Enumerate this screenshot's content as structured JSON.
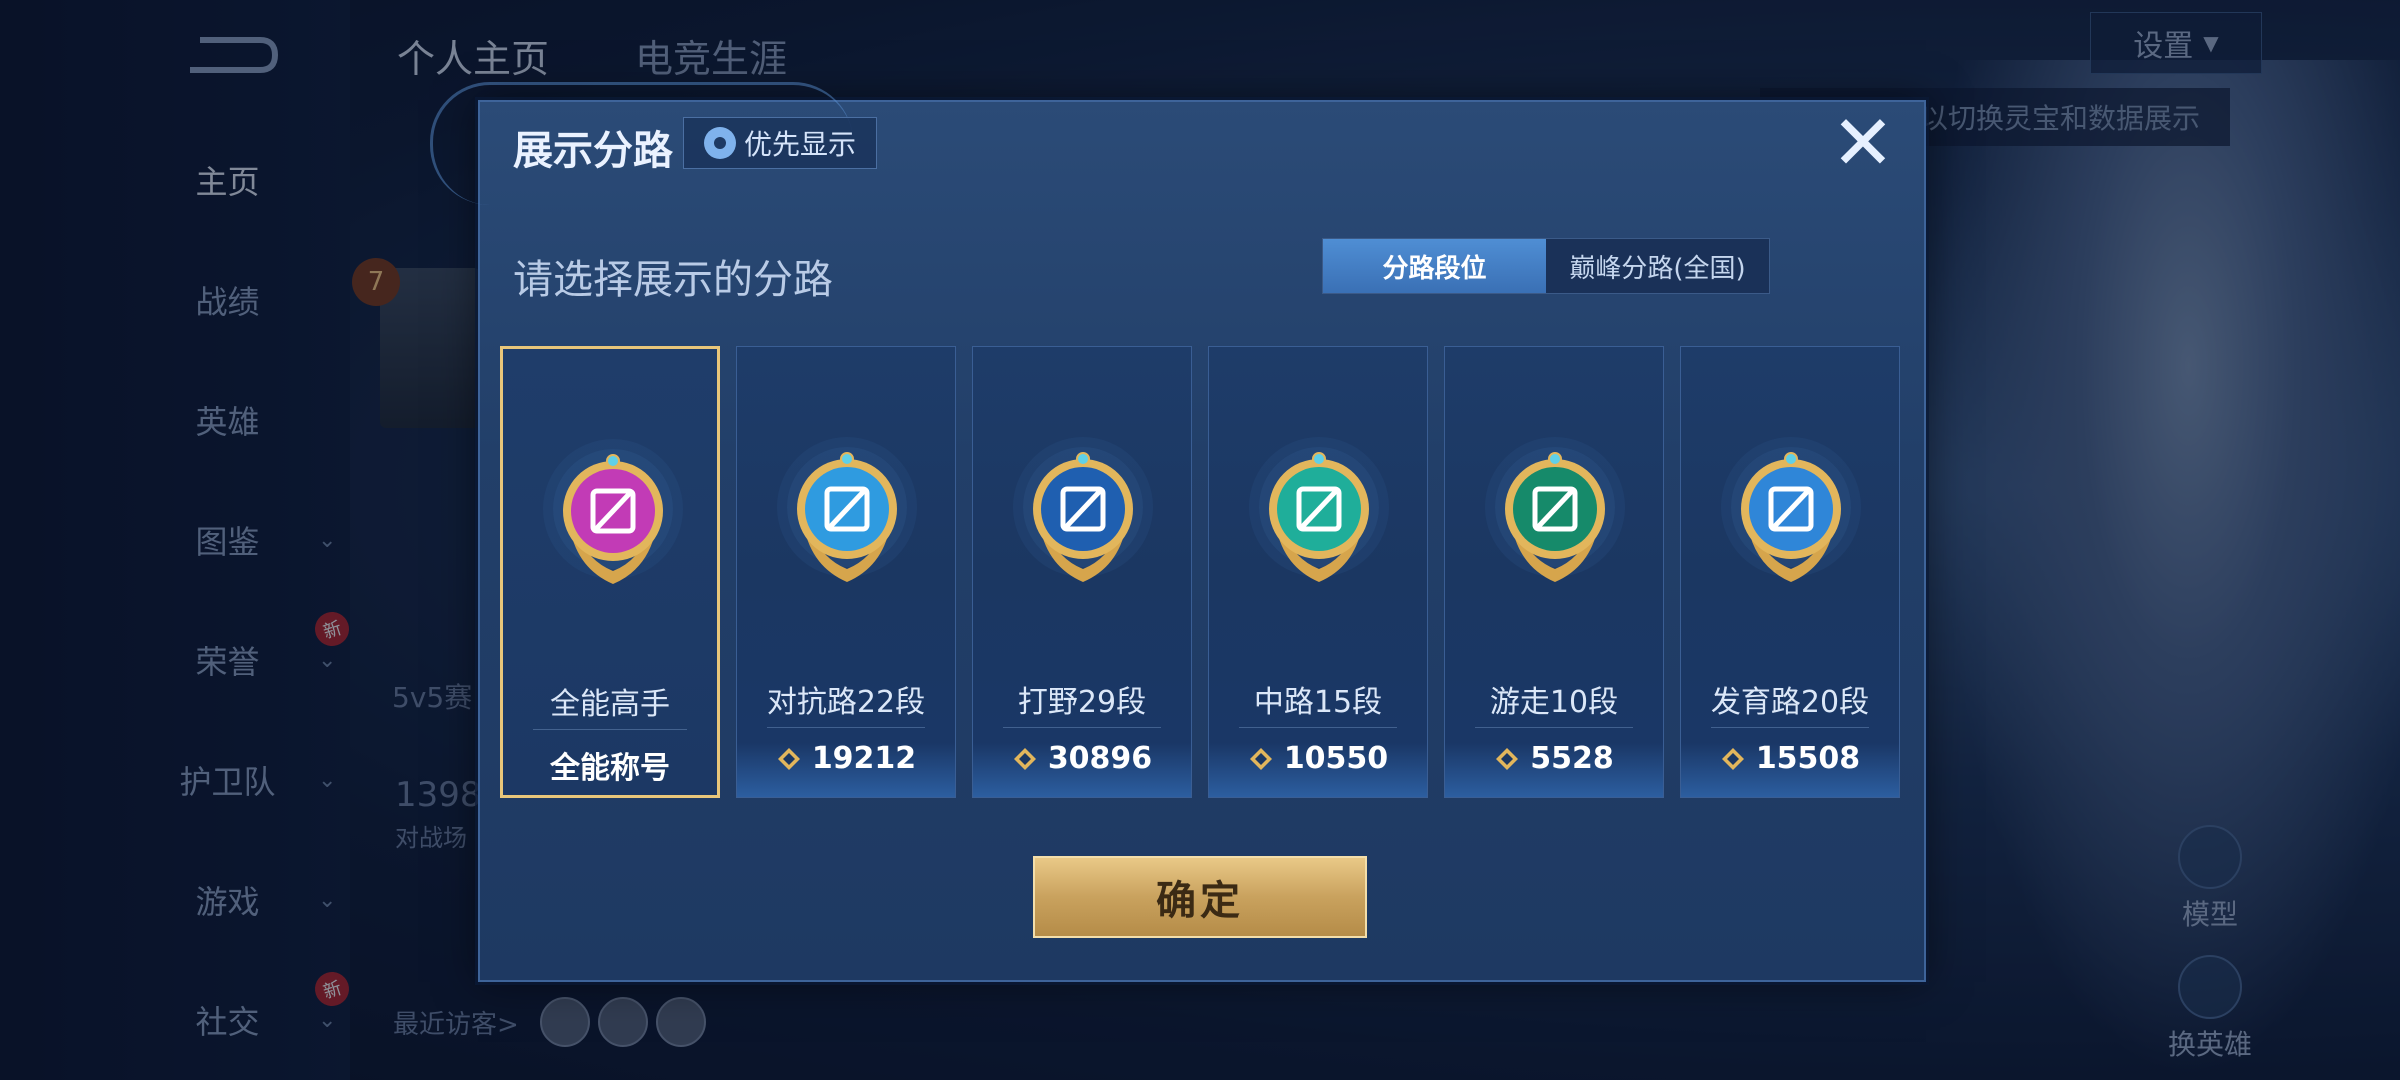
{
  "background": {
    "tabs": [
      "个人主页",
      "电竞生涯"
    ],
    "nav": [
      {
        "label": "主页",
        "chevron": false,
        "new": false
      },
      {
        "label": "战绩",
        "chevron": false,
        "new": false
      },
      {
        "label": "英雄",
        "chevron": false,
        "new": false
      },
      {
        "label": "图鉴",
        "chevron": true,
        "new": false
      },
      {
        "label": "荣誉",
        "chevron": true,
        "new": true
      },
      {
        "label": "护卫队",
        "chevron": true,
        "new": false
      },
      {
        "label": "游戏",
        "chevron": true,
        "new": false
      },
      {
        "label": "社交",
        "chevron": true,
        "new": true
      }
    ],
    "new_badge": "新",
    "level": "7",
    "mode_text": "5v5赛",
    "number_text": "1398",
    "sub_text": "对战场",
    "recent_visitors": "最近访客>",
    "settings_label": "设置",
    "hint_text": "以切换灵宝和数据展示",
    "model_label": "模型",
    "switch_hero_label": "换英雄"
  },
  "modal": {
    "title": "展示分路",
    "priority_label": "优先显示",
    "close_glyph": "✕",
    "subtitle": "请选择展示的分路",
    "segments": [
      {
        "label": "分路段位",
        "active": true
      },
      {
        "label": "巅峰分路(全国)",
        "active": false
      }
    ],
    "cards": [
      {
        "rank": "全能高手",
        "score": "全能称号",
        "medal_color": "#c23bb6",
        "selected": true,
        "icon": "all-round-icon"
      },
      {
        "rank": "对抗路22段",
        "score": "19212",
        "medal_color": "#2f9be0",
        "selected": false,
        "icon": "clash-lane-icon"
      },
      {
        "rank": "打野29段",
        "score": "30896",
        "medal_color": "#1f5fb0",
        "selected": false,
        "icon": "jungle-icon"
      },
      {
        "rank": "中路15段",
        "score": "10550",
        "medal_color": "#1fae9a",
        "selected": false,
        "icon": "mid-lane-icon"
      },
      {
        "rank": "游走10段",
        "score": "5528",
        "medal_color": "#168a6a",
        "selected": false,
        "icon": "roam-icon"
      },
      {
        "rank": "发育路20段",
        "score": "15508",
        "medal_color": "#2f86d8",
        "selected": false,
        "icon": "farm-lane-icon"
      }
    ],
    "confirm_label": "确定"
  },
  "colors": {
    "accent_gold": "#e8c67a",
    "selected_tab": "#3a70b5"
  }
}
